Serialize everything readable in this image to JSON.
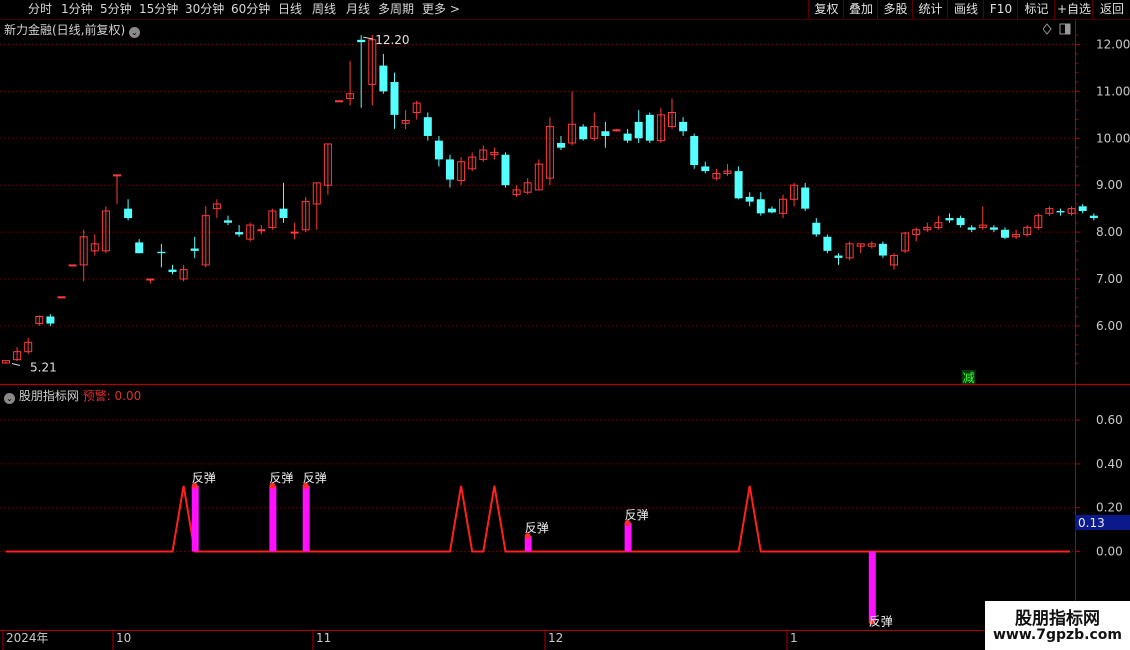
{
  "toolbar": {
    "periods": [
      "分时",
      "1分钟",
      "5分钟",
      "15分钟",
      "30分钟",
      "60分钟",
      "日线",
      "周线",
      "月线",
      "多周期",
      "更多 >"
    ],
    "actions": [
      "复权",
      "叠加",
      "多股",
      "统计",
      "画线",
      "F10",
      "标记",
      "+自选",
      "返回"
    ]
  },
  "main_chart": {
    "title": "新力金融(日线,前复权)",
    "high_label": "12.20",
    "low_label": "5.21",
    "reduce_badge": "减"
  },
  "indicator": {
    "name": "股朋指标网",
    "warn_label": "预警: 0.00",
    "current_value": "0.13",
    "signal_label": "反弹"
  },
  "date_axis": [
    "2024年",
    "10",
    "11",
    "12",
    "1"
  ],
  "watermark": {
    "title": "股朋指标网",
    "url": "www.7gpzb.com"
  },
  "colors": {
    "up": "#ff3b3b",
    "down": "#54ffff",
    "grid": "#7a0000",
    "axis": "#b00000",
    "signal_bar": "#ff10ff",
    "line": "#ff2020"
  },
  "chart_data": [
    {
      "type": "candlestick",
      "title": "新力金融(日线,前复权)",
      "y_ticks": [
        "12.00",
        "11.00",
        "10.00",
        "9.00",
        "8.00",
        "7.00",
        "6.00"
      ],
      "ylim": [
        5.0,
        12.3
      ],
      "annotations": [
        {
          "text": "12.20",
          "at": "max"
        },
        {
          "text": "5.21",
          "at": "min"
        }
      ],
      "candles": [
        [
          5.21,
          5.26,
          5.24,
          5.22
        ],
        [
          5.28,
          5.45,
          5.55,
          5.25
        ],
        [
          5.45,
          5.65,
          5.75,
          5.4
        ],
        [
          6.05,
          6.2,
          6.22,
          6.0
        ],
        [
          6.2,
          6.05,
          6.25,
          6.0
        ],
        [
          6.62,
          6.62,
          6.62,
          6.62
        ],
        [
          7.3,
          7.3,
          7.3,
          7.3
        ],
        [
          7.3,
          7.9,
          8.05,
          6.95
        ],
        [
          7.6,
          7.75,
          7.95,
          7.5
        ],
        [
          7.6,
          8.45,
          8.55,
          7.55
        ],
        [
          9.22,
          9.22,
          9.22,
          8.6
        ],
        [
          8.5,
          8.3,
          8.7,
          8.25
        ],
        [
          7.78,
          7.55,
          7.85,
          7.55
        ],
        [
          7.0,
          7.0,
          7.0,
          6.9
        ],
        [
          7.58,
          7.55,
          7.75,
          7.25
        ],
        [
          7.2,
          7.15,
          7.3,
          7.1
        ],
        [
          7.0,
          7.2,
          7.3,
          6.95
        ],
        [
          7.65,
          7.6,
          7.9,
          7.45
        ],
        [
          7.3,
          8.35,
          8.55,
          7.25
        ],
        [
          8.5,
          8.6,
          8.7,
          8.3
        ],
        [
          8.25,
          8.2,
          8.35,
          8.15
        ],
        [
          8.0,
          7.95,
          8.15,
          7.9
        ],
        [
          7.85,
          8.15,
          8.2,
          7.8
        ],
        [
          8.05,
          8.05,
          8.15,
          7.95
        ],
        [
          8.1,
          8.45,
          8.5,
          8.05
        ],
        [
          8.5,
          8.3,
          9.05,
          8.2
        ],
        [
          8.0,
          8.0,
          8.2,
          7.85
        ],
        [
          8.05,
          8.65,
          8.75,
          8.0
        ],
        [
          8.6,
          9.05,
          9.05,
          8.05
        ],
        [
          9.0,
          9.88,
          9.88,
          8.8
        ],
        [
          10.8,
          10.8,
          10.8,
          10.8
        ],
        [
          10.85,
          10.95,
          11.65,
          10.7
        ],
        [
          12.1,
          12.05,
          12.2,
          10.65
        ],
        [
          11.15,
          12.1,
          12.2,
          10.7
        ],
        [
          11.55,
          11.0,
          11.8,
          10.95
        ],
        [
          11.2,
          10.5,
          11.4,
          10.2
        ],
        [
          10.32,
          10.38,
          10.6,
          10.2
        ],
        [
          10.55,
          10.75,
          10.8,
          10.4
        ],
        [
          10.45,
          10.05,
          10.55,
          9.95
        ],
        [
          9.95,
          9.55,
          10.05,
          9.4
        ],
        [
          9.55,
          9.12,
          9.65,
          8.95
        ],
        [
          9.1,
          9.5,
          9.6,
          9.0
        ],
        [
          9.35,
          9.6,
          9.7,
          9.3
        ],
        [
          9.55,
          9.75,
          9.85,
          9.5
        ],
        [
          9.65,
          9.7,
          9.8,
          9.55
        ],
        [
          9.65,
          9.0,
          9.7,
          8.95
        ],
        [
          8.8,
          8.9,
          9.0,
          8.75
        ],
        [
          8.85,
          9.05,
          9.15,
          8.8
        ],
        [
          8.9,
          9.45,
          9.55,
          8.9
        ],
        [
          9.15,
          10.25,
          10.45,
          9.0
        ],
        [
          9.9,
          9.8,
          10.05,
          9.75
        ],
        [
          9.9,
          10.3,
          11.0,
          9.85
        ],
        [
          10.25,
          9.98,
          10.3,
          9.95
        ],
        [
          10.0,
          10.25,
          10.55,
          9.95
        ],
        [
          10.15,
          10.05,
          10.35,
          9.8
        ],
        [
          10.18,
          10.18,
          10.2,
          10.15
        ],
        [
          10.1,
          9.95,
          10.2,
          9.9
        ],
        [
          10.35,
          10.0,
          10.6,
          9.9
        ],
        [
          10.5,
          9.95,
          10.55,
          9.9
        ],
        [
          9.95,
          10.5,
          10.65,
          9.9
        ],
        [
          10.25,
          10.55,
          10.85,
          10.2
        ],
        [
          10.35,
          10.15,
          10.45,
          10.05
        ],
        [
          10.05,
          9.43,
          10.1,
          9.35
        ],
        [
          9.4,
          9.3,
          9.5,
          9.25
        ],
        [
          9.15,
          9.25,
          9.35,
          9.1
        ],
        [
          9.25,
          9.3,
          9.45,
          9.2
        ],
        [
          9.3,
          8.72,
          9.4,
          8.7
        ],
        [
          8.75,
          8.65,
          8.85,
          8.55
        ],
        [
          8.7,
          8.4,
          8.85,
          8.35
        ],
        [
          8.5,
          8.42,
          8.55,
          8.4
        ],
        [
          8.4,
          8.7,
          8.8,
          8.3
        ],
        [
          8.7,
          9.0,
          9.05,
          8.55
        ],
        [
          8.95,
          8.5,
          9.05,
          8.45
        ],
        [
          8.2,
          7.95,
          8.3,
          7.9
        ],
        [
          7.9,
          7.6,
          7.95,
          7.55
        ],
        [
          7.5,
          7.45,
          7.55,
          7.3
        ],
        [
          7.45,
          7.75,
          7.8,
          7.4
        ],
        [
          7.7,
          7.75,
          7.75,
          7.55
        ],
        [
          7.7,
          7.75,
          7.8,
          7.65
        ],
        [
          7.75,
          7.5,
          7.8,
          7.45
        ],
        [
          7.3,
          7.5,
          7.55,
          7.2
        ],
        [
          7.6,
          7.98,
          8.0,
          7.55
        ],
        [
          7.95,
          8.05,
          8.1,
          7.8
        ],
        [
          8.05,
          8.1,
          8.2,
          8.0
        ],
        [
          8.1,
          8.2,
          8.35,
          8.05
        ],
        [
          8.3,
          8.25,
          8.4,
          8.2
        ],
        [
          8.3,
          8.15,
          8.35,
          8.1
        ],
        [
          8.1,
          8.05,
          8.15,
          8.0
        ],
        [
          8.1,
          8.15,
          8.55,
          8.05
        ],
        [
          8.1,
          8.05,
          8.15,
          8.0
        ],
        [
          8.05,
          7.88,
          8.1,
          7.85
        ],
        [
          7.9,
          7.95,
          8.05,
          7.85
        ],
        [
          7.95,
          8.1,
          8.15,
          7.9
        ],
        [
          8.1,
          8.35,
          8.4,
          8.05
        ],
        [
          8.4,
          8.5,
          8.55,
          8.35
        ],
        [
          8.45,
          8.42,
          8.5,
          8.35
        ],
        [
          8.4,
          8.5,
          8.55,
          8.35
        ],
        [
          8.55,
          8.45,
          8.6,
          8.4
        ],
        [
          8.35,
          8.3,
          8.4,
          8.25
        ]
      ]
    },
    {
      "type": "line",
      "title": "股朋指标网",
      "y_ticks": [
        "0.60",
        "0.40",
        "0.20",
        "0.00"
      ],
      "ylim": [
        -0.38,
        0.75
      ],
      "line_baseline": 0.0,
      "line_peaks": [
        {
          "i": 16,
          "v": 0.3
        },
        {
          "i": 41,
          "v": 0.3
        },
        {
          "i": 44,
          "v": 0.3
        },
        {
          "i": 67,
          "v": 0.3
        }
      ],
      "signal_bars": [
        {
          "i": 17,
          "v": 0.3,
          "label": "反弹"
        },
        {
          "i": 24,
          "v": 0.3,
          "label": "反弹"
        },
        {
          "i": 27,
          "v": 0.3,
          "label": "反弹"
        },
        {
          "i": 47,
          "v": 0.07,
          "label": "反弹"
        },
        {
          "i": 56,
          "v": 0.13,
          "label": "反弹"
        },
        {
          "i": 78,
          "v": -0.32,
          "label": "反弹"
        }
      ],
      "current_value": 0.13
    }
  ]
}
